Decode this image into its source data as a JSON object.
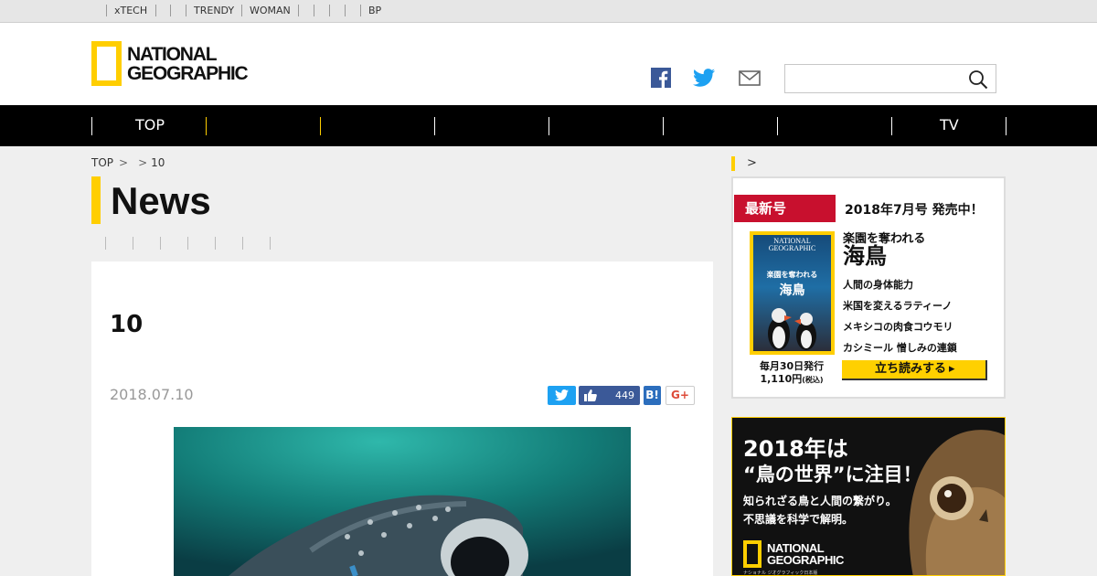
{
  "util_links": [
    "xTECH",
    "TRENDY",
    "WOMAN",
    "BP"
  ],
  "brand": {
    "line1": "NATIONAL",
    "line2": "GEOGRAPHIC"
  },
  "header": {
    "search_placeholder": ""
  },
  "nav": {
    "items": [
      "TOP",
      "TV"
    ]
  },
  "breadcrumb": {
    "home": "TOP",
    "current": "10"
  },
  "section": {
    "title": "News"
  },
  "article": {
    "title": "10",
    "date": "2018.07.10",
    "share": {
      "like_count": "449",
      "hatena": "B!",
      "gplus": "G+"
    }
  },
  "magazine": {
    "badge": "最新号",
    "issue": "2018年7月号 発売中！",
    "lead_small": "楽園を奪われる",
    "lead_big": "海鳥",
    "lines": [
      "人間の身体能力",
      "米国を変えるラティーノ",
      "メキシコの肉食コウモリ",
      "カシミール 憎しみの連鎖"
    ],
    "release": "毎月30日発行",
    "price": "1,110円",
    "tax": "(税込)",
    "read_button": "立ち読みする",
    "cover": {
      "logo1": "NATIONAL",
      "logo2": "GEOGRAPHIC",
      "title_small": "楽園を奪われる",
      "title_big": "海鳥"
    }
  },
  "ad": {
    "l1": "2018年は",
    "l2": "“鳥の世界”に注目！",
    "l3": "知られざる鳥と人間の繋がり。",
    "l4": "不思議を科学で解明。",
    "logo1": "NATIONAL",
    "logo2": "GEOGRAPHIC",
    "sub": "ナショナル ジオグラフィック日本版"
  },
  "colors": {
    "brand_yellow": "#ffce00",
    "nav_bg": "#000000",
    "badge_red": "#c8102e",
    "twitter": "#1da1f2",
    "facebook": "#3b5998"
  }
}
